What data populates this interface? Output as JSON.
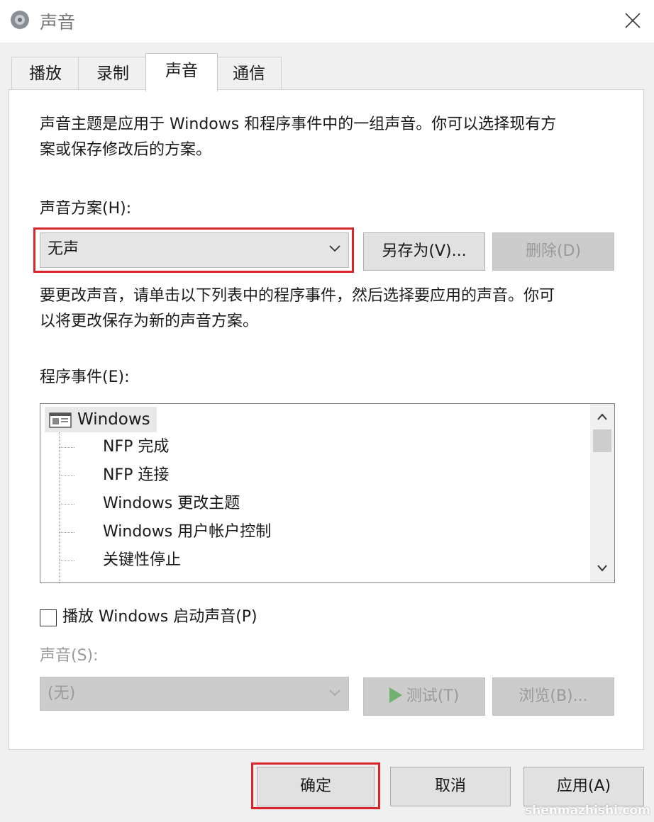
{
  "window": {
    "title": "声音",
    "close_icon": "close-icon",
    "app_icon": "speaker-icon"
  },
  "tabs": [
    {
      "label": "播放"
    },
    {
      "label": "录制"
    },
    {
      "label": "声音",
      "active": true
    },
    {
      "label": "通信"
    }
  ],
  "sounds_tab": {
    "description_line1": "声音主题是应用于 Windows 和程序事件中的一组声音。你可以选择现有方",
    "description_line2": "案或保存修改后的方案。",
    "scheme_label": "声音方案(H):",
    "scheme_value": "无声",
    "save_as_label": "另存为(V)...",
    "delete_label": "删除(D)",
    "instruction_line1": "要更改声音，请单击以下列表中的程序事件，然后选择要应用的声音。你可",
    "instruction_line2": "以将更改保存为新的声音方案。",
    "events_label": "程序事件(E):",
    "events_root": "Windows",
    "events": [
      {
        "label": "NFP 完成"
      },
      {
        "label": "NFP 连接"
      },
      {
        "label": "Windows 更改主题"
      },
      {
        "label": "Windows 用户帐户控制"
      },
      {
        "label": "关键性停止"
      }
    ],
    "startup_checkbox_label": "播放 Windows 启动声音(P)",
    "startup_checked": false,
    "sound_label": "声音(S):",
    "sound_value": "(无)",
    "test_label": "测试(T)",
    "browse_label": "浏览(B)..."
  },
  "footer": {
    "ok_label": "确定",
    "cancel_label": "取消",
    "apply_label": "应用(A)"
  },
  "colors": {
    "highlight": "#d9262c",
    "play_icon": "#6fb36f"
  },
  "watermark": "shenmazhishi.com"
}
